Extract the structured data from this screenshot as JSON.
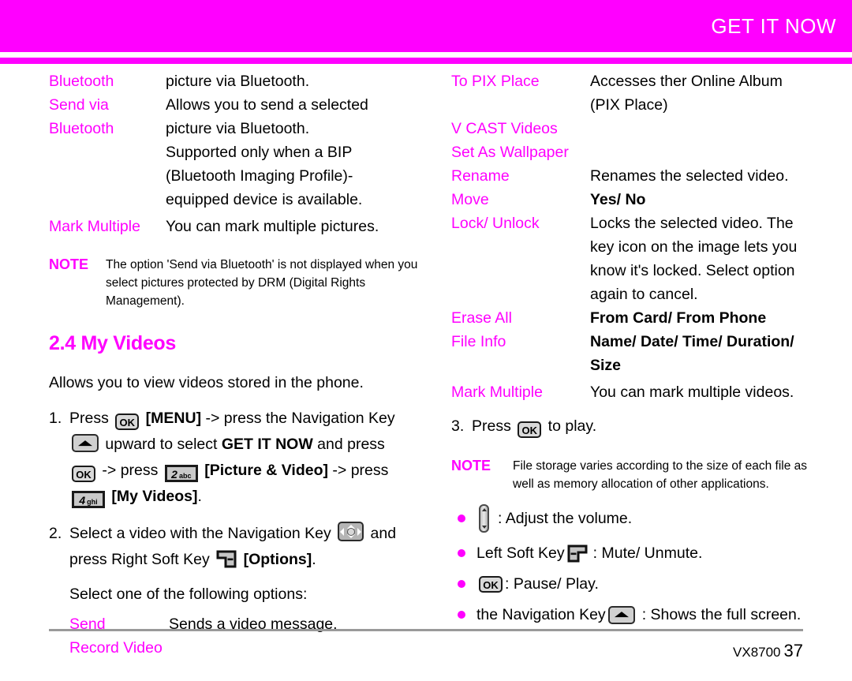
{
  "header": {
    "title": "GET IT NOW",
    "accent_color": "#ff00ff",
    "title_color": "#ffffff"
  },
  "footer": {
    "model": "VX8700",
    "page": "37"
  },
  "left_column": {
    "picture_options": [
      {
        "term": "Bluetooth",
        "desc": "picture via Bluetooth."
      },
      {
        "term": "Send via\nBluetooth",
        "desc": "Allows you to send a selected\npicture via Bluetooth.\nSupported only when a BIP\n(Bluetooth Imaging Profile)-\nequipped device is available."
      },
      {
        "term": "Mark Multiple",
        "desc": "You can mark multiple pictures."
      }
    ],
    "note": {
      "label": "NOTE",
      "body": "The option 'Send via Bluetooth' is not displayed when you select pictures protected by DRM (Digital Rights Management)."
    },
    "section_heading": "2.4 My Videos",
    "intro": "Allows you to view videos stored in the phone.",
    "step1": {
      "num": "1.",
      "t1": "Press ",
      "key_ok_1": "OK",
      "t2": " [MENU] -> press the Navigation Key ",
      "key_nav": "navigation-key-4way",
      "t3": " upward to select ",
      "t4": "GET IT NOW",
      "t5": " and press ",
      "key_ok_2": "OK",
      "t6": " -> press ",
      "key_2": {
        "number": "2",
        "letters": "abc"
      },
      "t7": " [Picture & Video] -> press ",
      "key_4": {
        "number": "4",
        "letters": "ghi"
      },
      "t8": " [My Videos]."
    },
    "step2": {
      "num": "2.",
      "t1": "Select a video with the Navigation Key ",
      "t2": " and press Right Soft Key ",
      "t3": " [Options]."
    },
    "select_options_line": "Select one of the following options:",
    "video_options": [
      {
        "term": "Send",
        "desc": "Sends a video message."
      },
      {
        "term": "Record Video",
        "desc": ""
      }
    ]
  },
  "right_column": {
    "video_options": [
      {
        "term": "To PIX Place",
        "desc": "Accesses ther Online Album\n(PIX Place)",
        "bold": false
      },
      {
        "term": "V CAST Videos",
        "desc": "",
        "bold": false
      },
      {
        "term": "Set As Wallpaper",
        "desc": "",
        "bold": false
      },
      {
        "term": "Rename",
        "desc": "Renames the selected video.",
        "bold": false
      },
      {
        "term": "Move",
        "desc": "Yes/ No",
        "bold": true
      },
      {
        "term": "Lock/ Unlock",
        "desc": "Locks the selected video. The\nkey icon on the image lets you\nknow it's locked. Select option\nagain to cancel.",
        "bold": false
      },
      {
        "term": "Erase All",
        "desc": "From Card/ From Phone",
        "bold": true
      },
      {
        "term": "File Info",
        "desc": "Name/ Date/ Time/ Duration/\nSize",
        "bold": true
      },
      {
        "term": "Mark Multiple",
        "desc": "You can mark multiple videos.",
        "bold": false
      }
    ],
    "step3": {
      "num": "3.",
      "t1": "Press ",
      "key_ok": "OK",
      "t2": " to play."
    },
    "note": {
      "label": "NOTE",
      "body": "File storage varies according to the size of each file as well as memory allocation of other applications."
    },
    "bullets": [
      {
        "icon": "volume-rocker-key",
        "pre": "",
        "post": ": Adjust the volume."
      },
      {
        "icon": "left-soft-key",
        "pre": "Left Soft Key ",
        "post": ": Mute/ Unmute."
      },
      {
        "icon": "ok-key",
        "pre": "",
        "post": ": Pause/ Play.",
        "key_label": "OK"
      },
      {
        "icon": "navigation-up-key",
        "pre": "the Navigation Key ",
        "post": ": Shows the full screen."
      }
    ]
  }
}
